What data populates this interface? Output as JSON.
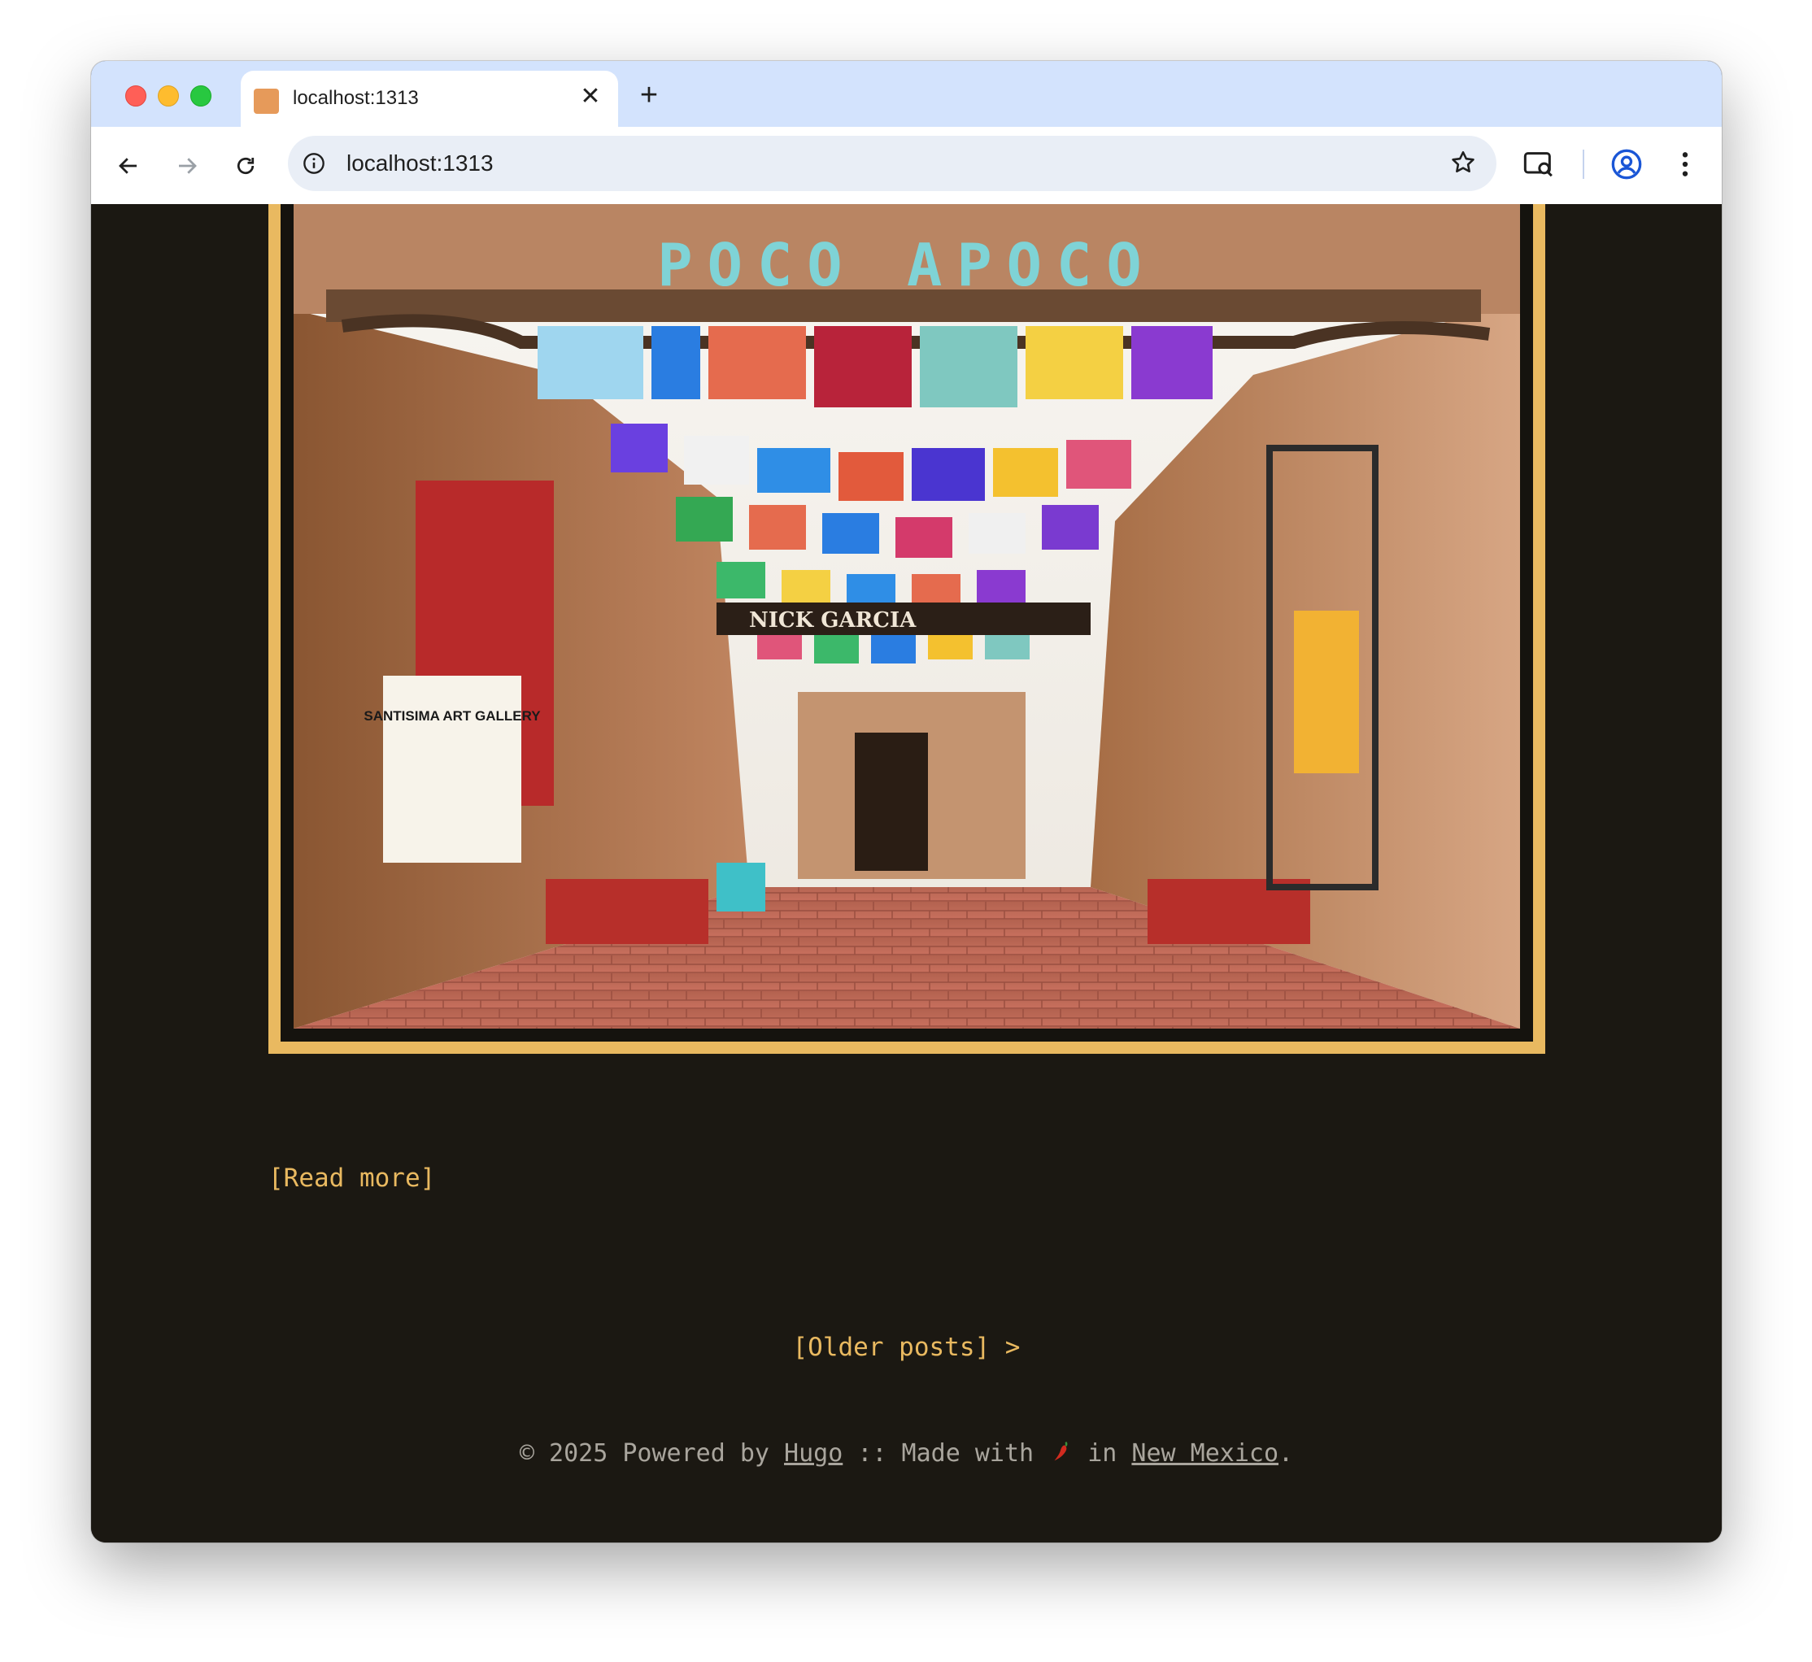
{
  "browser": {
    "tab_title": "localhost:1313",
    "url": "localhost:1313"
  },
  "image": {
    "sign_text": "POCO APOCO",
    "gallery_sign_title": "SANTISIMA ART GALLERY",
    "shop_sign": "NICK GARCIA"
  },
  "post": {
    "read_more": "[Read more]"
  },
  "pagination": {
    "older_posts": "[Older posts] >"
  },
  "footer": {
    "prefix": "© 2025 Powered by ",
    "hugo_link": "Hugo",
    "middle": " :: Made with ",
    "in_text": " in ",
    "nm_link": "New Mexico",
    "suffix": "."
  },
  "colors": {
    "accent": "#e9b960",
    "page_bg": "#1b1812",
    "footer_text": "#a9a59d"
  }
}
